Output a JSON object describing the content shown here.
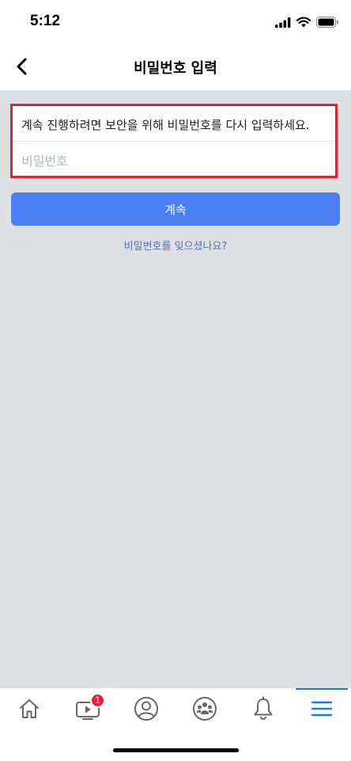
{
  "status_bar": {
    "time": "5:12",
    "icons": [
      "signal-icon",
      "wifi-icon",
      "battery-icon"
    ]
  },
  "header": {
    "title": "비밀번호 입력",
    "back_icon": "chevron-left-icon"
  },
  "form": {
    "instruction": "계속 진행하려면 보안을 위해 비밀번호를 다시 입력하세요.",
    "password_placeholder": "비밀번호",
    "password_value": "",
    "continue_label": "계속",
    "forgot_label": "비밀번호를 잊으셨나요?"
  },
  "tab_bar": {
    "tabs": [
      {
        "icon": "home-icon"
      },
      {
        "icon": "watch-video-icon",
        "badge": "1"
      },
      {
        "icon": "profile-icon"
      },
      {
        "icon": "groups-icon"
      },
      {
        "icon": "bell-icon"
      },
      {
        "icon": "menu-icon",
        "active": true
      }
    ]
  },
  "colors": {
    "accent": "#4b7ff7",
    "highlight_border": "#e0212f",
    "link": "#5470a8",
    "background": "#dfe0e4",
    "badge": "#e41e3f"
  }
}
